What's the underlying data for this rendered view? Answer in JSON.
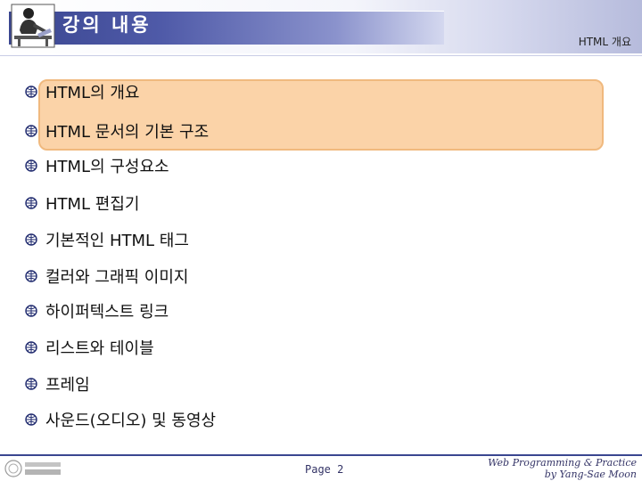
{
  "slide": {
    "title": "강의 내용",
    "topic_label": "HTML 개요"
  },
  "outline": {
    "items": [
      {
        "label": "HTML의 개요"
      },
      {
        "label": "HTML 문서의 기본 구조"
      },
      {
        "label": "HTML의 구성요소"
      },
      {
        "label": "HTML 편집기"
      },
      {
        "label": "기본적인 HTML 태그"
      },
      {
        "label": "컬러와 그래픽 이미지"
      },
      {
        "label": "하이퍼텍스트 링크"
      },
      {
        "label": "리스트와 테이블"
      },
      {
        "label": "프레임"
      },
      {
        "label": "사운드(오디오) 및 동영상"
      }
    ],
    "highlighted_items": [
      0,
      1
    ],
    "highlight_color": "#fbd3a8",
    "bullet_icon": "globe-bullet-icon"
  },
  "footer": {
    "page_label": "Page 2",
    "credit_line1": "Web Programming & Practice",
    "credit_line2": "by Yang-Sae Moon",
    "accent_color": "#3a4690"
  }
}
